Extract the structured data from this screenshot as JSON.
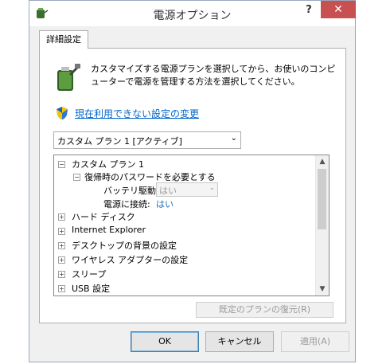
{
  "window": {
    "title": "電源オプション",
    "help": "?",
    "close": "✕"
  },
  "tab": {
    "label": "詳細設定"
  },
  "description": "カスタマイズする電源プランを選択してから、お使いのコンピューターで電源を管理する方法を選択してください。",
  "link": "現在利用できない設定の変更",
  "plan_select": {
    "value": "カスタム プラン 1 [アクティブ]"
  },
  "tree": {
    "root": {
      "toggle": "⊟",
      "label": "カスタム プラン 1"
    },
    "password": {
      "toggle": "⊟",
      "label": "復帰時のパスワードを必要とする"
    },
    "battery": {
      "label": "バッテリ駆動:",
      "value": "はい"
    },
    "plugged": {
      "label": "電源に接続:",
      "value": "はい"
    },
    "items": [
      {
        "toggle": "⊞",
        "label": "ハード ディスク"
      },
      {
        "toggle": "⊞",
        "label": "Internet Explorer"
      },
      {
        "toggle": "⊞",
        "label": "デスクトップの背景の設定"
      },
      {
        "toggle": "⊞",
        "label": "ワイヤレス アダプターの設定"
      },
      {
        "toggle": "⊞",
        "label": "スリープ"
      },
      {
        "toggle": "⊞",
        "label": "USB 設定"
      }
    ]
  },
  "restore_button": "既定のプランの復元(R)",
  "buttons": {
    "ok": "OK",
    "cancel": "キャンセル",
    "apply": "適用(A)"
  },
  "icons": {
    "app": "battery-plug-icon",
    "battery": "battery-plug-icon",
    "shield": "uac-shield-icon"
  }
}
